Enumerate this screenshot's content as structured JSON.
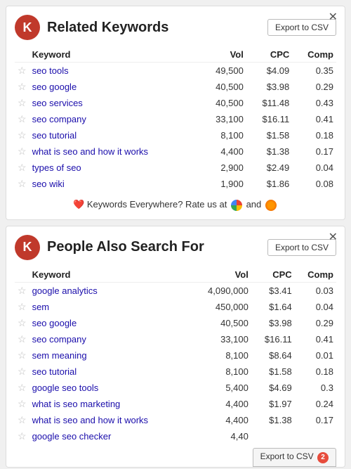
{
  "related_keywords": {
    "title": "Related Keywords",
    "logo_letter": "K",
    "export_label": "Export to CSV",
    "close_label": "✕",
    "columns": [
      "Keyword",
      "Vol",
      "CPC",
      "Comp"
    ],
    "rows": [
      {
        "keyword": "seo tools",
        "vol": "49,500",
        "cpc": "$4.09",
        "comp": "0.35"
      },
      {
        "keyword": "seo google",
        "vol": "40,500",
        "cpc": "$3.98",
        "comp": "0.29"
      },
      {
        "keyword": "seo services",
        "vol": "40,500",
        "cpc": "$11.48",
        "comp": "0.43"
      },
      {
        "keyword": "seo company",
        "vol": "33,100",
        "cpc": "$16.11",
        "comp": "0.41"
      },
      {
        "keyword": "seo tutorial",
        "vol": "8,100",
        "cpc": "$1.58",
        "comp": "0.18"
      },
      {
        "keyword": "what is seo and how it works",
        "vol": "4,400",
        "cpc": "$1.38",
        "comp": "0.17"
      },
      {
        "keyword": "types of seo",
        "vol": "2,900",
        "cpc": "$2.49",
        "comp": "0.04"
      },
      {
        "keyword": "seo wiki",
        "vol": "1,900",
        "cpc": "$1.86",
        "comp": "0.08"
      }
    ],
    "rate_text": "Keywords Everywhere? Rate us at",
    "rate_and": "and"
  },
  "people_search": {
    "title": "People Also Search For",
    "logo_letter": "K",
    "export_label": "Export to CSV",
    "close_label": "✕",
    "badge": "2",
    "columns": [
      "Keyword",
      "Vol",
      "CPC",
      "Comp"
    ],
    "rows": [
      {
        "keyword": "google analytics",
        "vol": "4,090,000",
        "cpc": "$3.41",
        "comp": "0.03"
      },
      {
        "keyword": "sem",
        "vol": "450,000",
        "cpc": "$1.64",
        "comp": "0.04"
      },
      {
        "keyword": "seo google",
        "vol": "40,500",
        "cpc": "$3.98",
        "comp": "0.29"
      },
      {
        "keyword": "seo company",
        "vol": "33,100",
        "cpc": "$16.11",
        "comp": "0.41"
      },
      {
        "keyword": "sem meaning",
        "vol": "8,100",
        "cpc": "$8.64",
        "comp": "0.01"
      },
      {
        "keyword": "seo tutorial",
        "vol": "8,100",
        "cpc": "$1.58",
        "comp": "0.18"
      },
      {
        "keyword": "google seo tools",
        "vol": "5,400",
        "cpc": "$4.69",
        "comp": "0.3"
      },
      {
        "keyword": "what is seo marketing",
        "vol": "4,400",
        "cpc": "$1.97",
        "comp": "0.24"
      },
      {
        "keyword": "what is seo and how it works",
        "vol": "4,400",
        "cpc": "$1.38",
        "comp": "0.17"
      },
      {
        "keyword": "google seo checker",
        "vol": "4,40",
        "cpc": "",
        "comp": ""
      }
    ]
  }
}
